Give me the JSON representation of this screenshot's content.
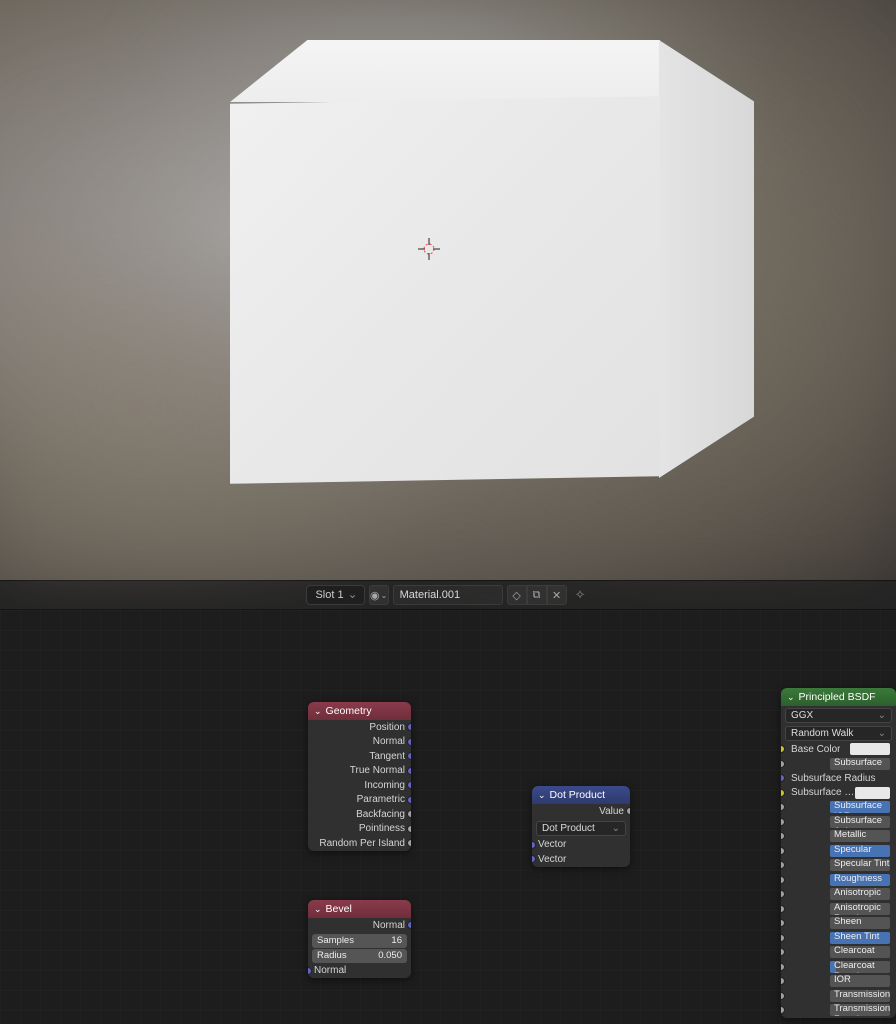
{
  "header": {
    "slot": "Slot 1",
    "material_name": "Material.001"
  },
  "nodes": {
    "geometry": {
      "title": "Geometry",
      "outputs": [
        "Position",
        "Normal",
        "Tangent",
        "True Normal",
        "Incoming",
        "Parametric",
        "Backfacing",
        "Pointiness",
        "Random Per Island"
      ]
    },
    "bevel": {
      "title": "Bevel",
      "output": "Normal",
      "samples_label": "Samples",
      "samples_value": "16",
      "radius_label": "Radius",
      "radius_value": "0.050",
      "input": "Normal"
    },
    "dot": {
      "title": "Dot Product",
      "output": "Value",
      "operation": "Dot Product",
      "in1": "Vector",
      "in2": "Vector"
    },
    "principled": {
      "title": "Principled BSDF",
      "dist": "GGX",
      "sss": "Random Walk",
      "rows": [
        {
          "label": "Base Color",
          "type": "color"
        },
        {
          "label": "Subsurface",
          "type": "slider",
          "fill": 0
        },
        {
          "label": "Subsurface Radius",
          "type": "plain"
        },
        {
          "label": "Subsurface Co...",
          "type": "color"
        },
        {
          "label": "Subsurface IOR",
          "type": "slider",
          "fill": 100
        },
        {
          "label": "Subsurface Anisotropy",
          "type": "slider",
          "fill": 0
        },
        {
          "label": "Metallic",
          "type": "slider",
          "fill": 0
        },
        {
          "label": "Specular",
          "type": "slider",
          "fill": 100
        },
        {
          "label": "Specular Tint",
          "type": "slider",
          "fill": 0
        },
        {
          "label": "Roughness",
          "type": "slider",
          "fill": 100
        },
        {
          "label": "Anisotropic",
          "type": "slider",
          "fill": 0
        },
        {
          "label": "Anisotropic Rotation",
          "type": "slider",
          "fill": 0
        },
        {
          "label": "Sheen",
          "type": "slider",
          "fill": 0
        },
        {
          "label": "Sheen Tint",
          "type": "slider",
          "fill": 100
        },
        {
          "label": "Clearcoat",
          "type": "slider",
          "fill": 0
        },
        {
          "label": "Clearcoat Roughness",
          "type": "slider",
          "fill": 10
        },
        {
          "label": "IOR",
          "type": "slider",
          "fill": 0
        },
        {
          "label": "Transmission",
          "type": "slider",
          "fill": 0
        },
        {
          "label": "Transmission Roughness",
          "type": "slider",
          "fill": 0
        }
      ]
    }
  }
}
